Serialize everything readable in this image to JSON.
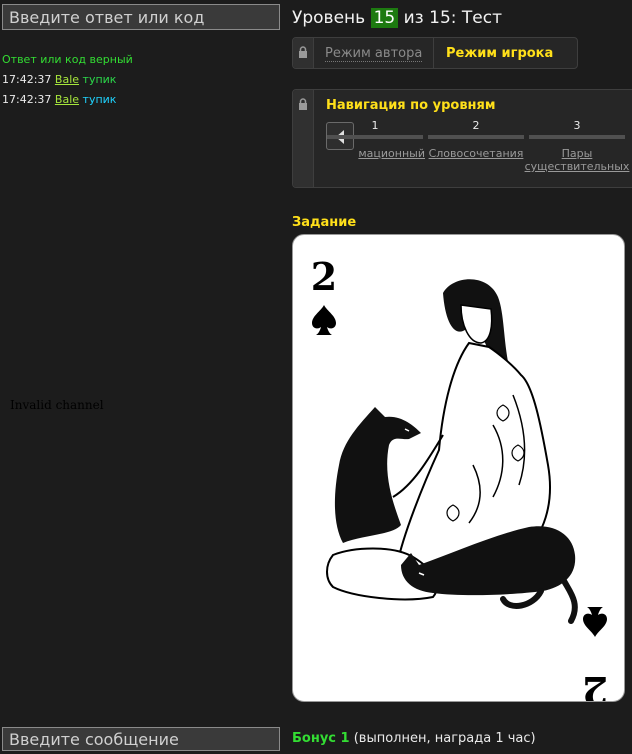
{
  "left": {
    "answer_placeholder": "Введите ответ или код",
    "status": "Ответ или код верный",
    "log": [
      {
        "time": "17:42:37",
        "user": "Bale",
        "result": "тупик"
      },
      {
        "time": "17:42:37",
        "user": "Bale",
        "result": "тупик"
      }
    ],
    "chat_error": "Invalid channel",
    "message_placeholder": "Введите сообщение"
  },
  "level": {
    "prefix": "Уровень",
    "current": "15",
    "of": "из",
    "total": "15:",
    "name": "Тест"
  },
  "modes": {
    "author": "Режим автора",
    "player": "Режим игрока"
  },
  "navigation": {
    "title": "Навигация по уровням",
    "levels": [
      {
        "num": "1",
        "name": "мационный"
      },
      {
        "num": "2",
        "name": "Словосочетания"
      },
      {
        "num": "3",
        "name_line1": "Пары",
        "name_line2": "существительных"
      }
    ]
  },
  "task": {
    "label": "Задание",
    "card_rank": "2"
  },
  "bonus": {
    "label": "Бонус 1",
    "info": "(выполнен, награда 1 час)"
  },
  "colors": {
    "background": "#1c1c1c",
    "accent_yellow": "#ffe01a",
    "success_green": "#33dd33",
    "level_badge": "#1d7a10",
    "link_cyan": "#1fd3ff",
    "user_link": "#a6e63c"
  }
}
